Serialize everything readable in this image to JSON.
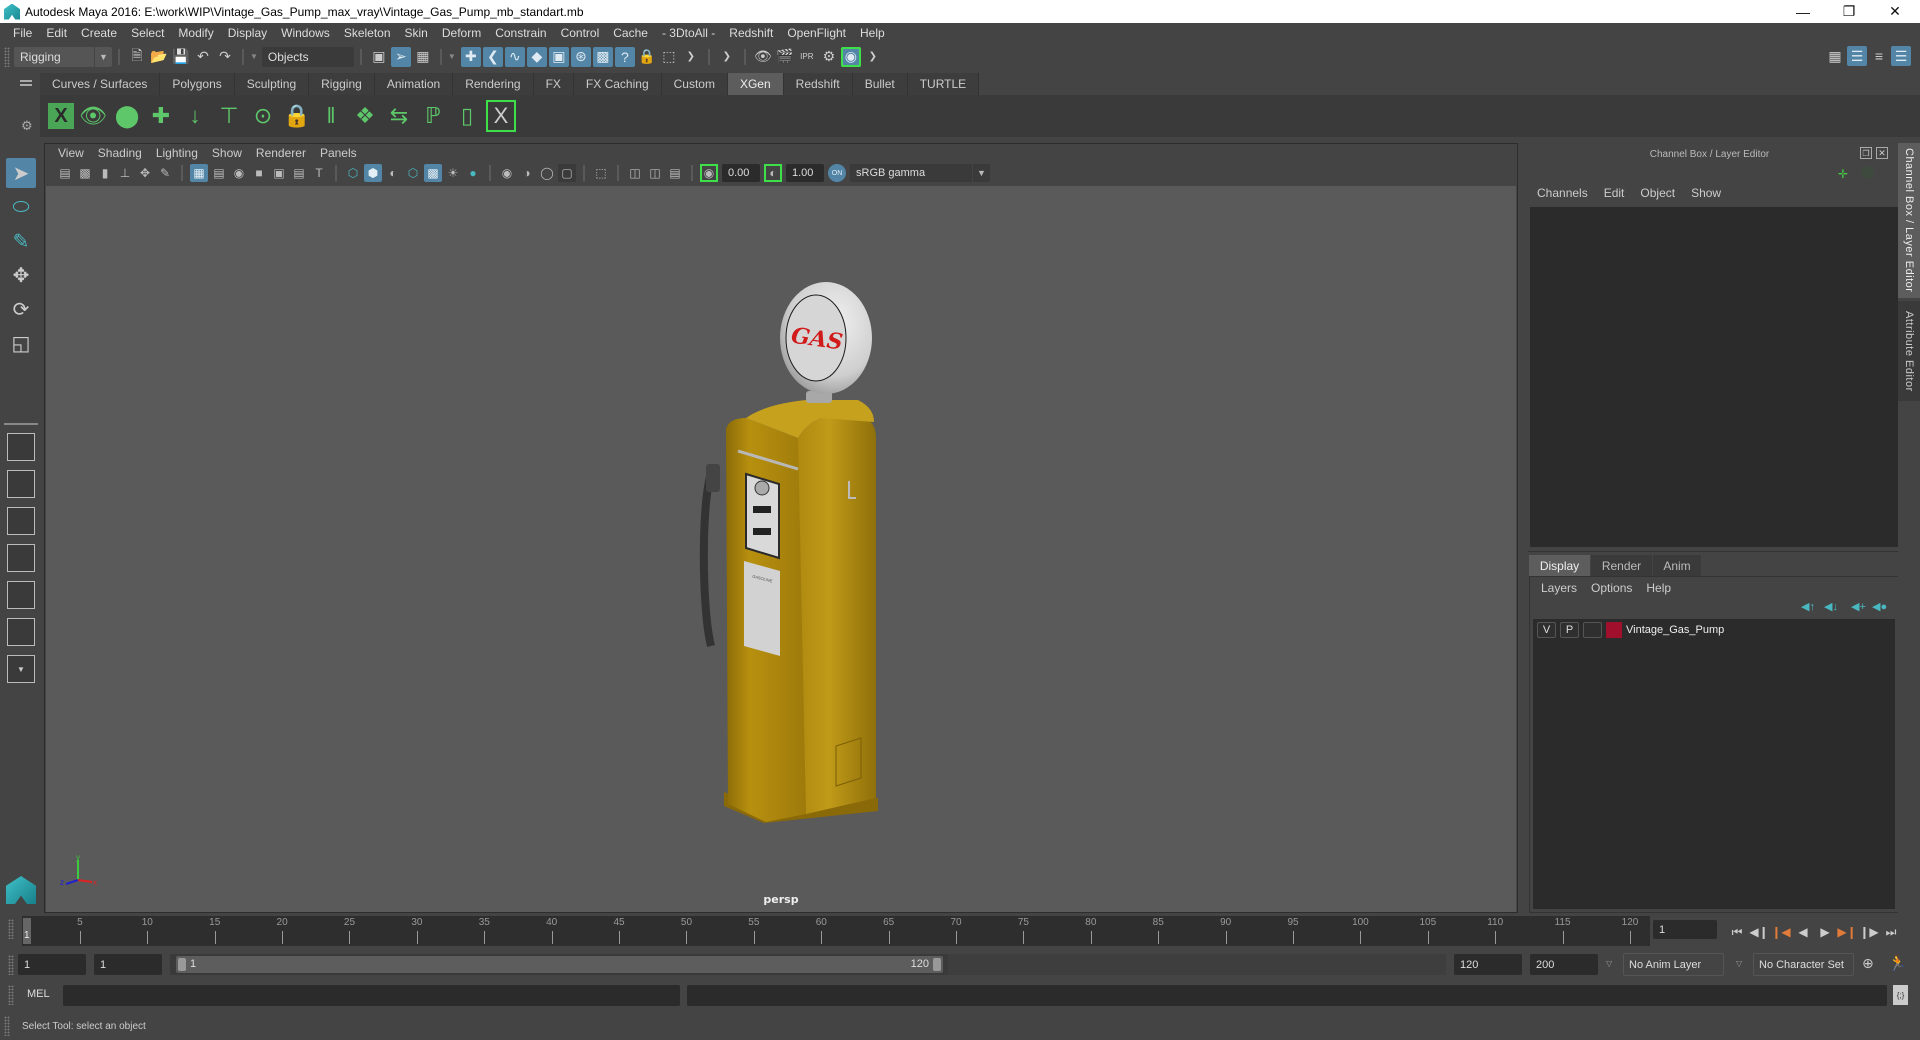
{
  "window": {
    "title": "Autodesk Maya 2016: E:\\work\\WIP\\Vintage_Gas_Pump_max_vray\\Vintage_Gas_Pump_mb_standart.mb",
    "controls": [
      "minimize-icon",
      "restore-icon",
      "close-icon"
    ]
  },
  "menubar": [
    "File",
    "Edit",
    "Create",
    "Select",
    "Modify",
    "Display",
    "Windows",
    "Skeleton",
    "Skin",
    "Deform",
    "Constrain",
    "Control",
    "Cache",
    "- 3DtoAll -",
    "Redshift",
    "OpenFlight",
    "Help"
  ],
  "statusline": {
    "menuset": "Rigging",
    "selection_mode": "Objects"
  },
  "shelf": {
    "tabs": [
      "Curves / Surfaces",
      "Polygons",
      "Sculpting",
      "Rigging",
      "Animation",
      "Rendering",
      "FX",
      "FX Caching",
      "Custom",
      "XGen",
      "Redshift",
      "Bullet",
      "TURTLE"
    ],
    "active_tab": "XGen",
    "icons": [
      "xgen-window-icon",
      "xgen-preview-icon",
      "xgen-hide-icon",
      "xgen-add-guide-icon",
      "xgen-sculpt-guide-icon",
      "xgen-add-guide-tool-icon",
      "xgen-visibility-guide-icon",
      "xgen-lock-guide-icon",
      "xgen-split-guide-icon",
      "xgen-pattern-icon",
      "xgen-flip-guide-icon",
      "xgen-select-guide-icon",
      "xgen-guide-outline-icon",
      "xgen-interactive-groom-icon"
    ]
  },
  "viewport": {
    "menu": [
      "View",
      "Shading",
      "Lighting",
      "Show",
      "Renderer",
      "Panels"
    ],
    "exposure": "0.00",
    "gamma": "1.00",
    "color_space": "sRGB gamma",
    "camera_label": "persp",
    "model": {
      "sign_text": "GAS",
      "panel_text": "GASOLINE",
      "body_color": "#b8900f",
      "sign_color": "#d11b1b"
    }
  },
  "channel_box": {
    "title": "Channel Box / Layer Editor",
    "menu": [
      "Channels",
      "Edit",
      "Object",
      "Show"
    ]
  },
  "layer_editor": {
    "tabs": [
      "Display",
      "Render",
      "Anim"
    ],
    "active_tab": "Display",
    "menu": [
      "Layers",
      "Options",
      "Help"
    ],
    "layers": [
      {
        "visible": "V",
        "playback": "P",
        "type": "",
        "color": "#a0102c",
        "name": "Vintage_Gas_Pump"
      }
    ]
  },
  "side_tabs": [
    "Channel Box / Layer Editor",
    "Attribute Editor"
  ],
  "timeline": {
    "ticks": [
      5,
      10,
      15,
      20,
      25,
      30,
      35,
      40,
      45,
      50,
      55,
      60,
      65,
      70,
      75,
      80,
      85,
      90,
      95,
      100,
      105,
      110,
      115,
      120
    ],
    "start": 1,
    "end": 120,
    "current_frame": "1",
    "current_frame_marker": "1"
  },
  "range": {
    "start_field": "1",
    "playback_start": "1",
    "slider_start": "1",
    "slider_end": "120",
    "playback_end": "120",
    "end_field": "200",
    "anim_layer": "No Anim Layer",
    "character_set": "No Character Set"
  },
  "command_line": {
    "label": "MEL",
    "value": "",
    "result": ""
  },
  "help_line": "Select Tool: select an object"
}
